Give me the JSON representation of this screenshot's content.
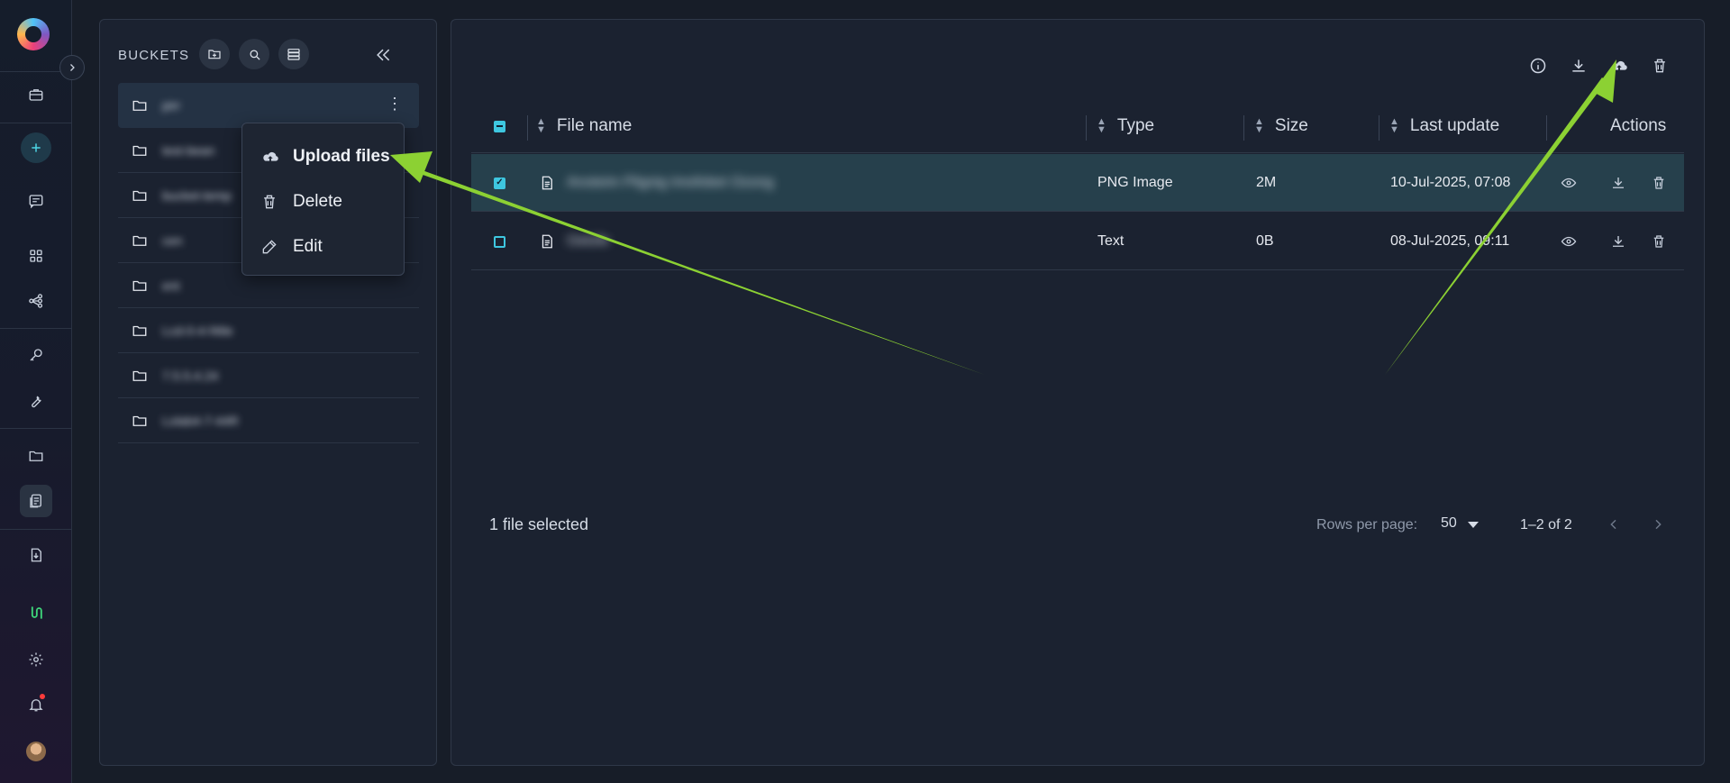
{
  "sidebar": {
    "expand_icon": "chevron-right-icon",
    "items": [
      {
        "name": "briefcase-icon"
      },
      {
        "name": "plus-icon"
      },
      {
        "name": "chat-icon"
      },
      {
        "name": "grid-icon"
      },
      {
        "name": "workflow-icon"
      },
      {
        "name": "key-icon"
      },
      {
        "name": "wrench-icon"
      },
      {
        "name": "folder-icon"
      },
      {
        "name": "files-icon",
        "active": true
      },
      {
        "name": "file-download-icon"
      },
      {
        "name": "flow-icon"
      },
      {
        "name": "settings-icon"
      },
      {
        "name": "bell-icon"
      }
    ]
  },
  "buckets": {
    "title": "BUCKETS",
    "items": [
      {
        "label": "pirr"
      },
      {
        "label": "test-bean"
      },
      {
        "label": "bucket-temp"
      },
      {
        "label": "cen"
      },
      {
        "label": "ent"
      },
      {
        "label": "Lcd-0-4-f4tle"
      },
      {
        "label": "7.5.5.4.24"
      },
      {
        "label": "Lolab4-7-44R"
      }
    ]
  },
  "context_menu": {
    "items": [
      {
        "label": "Upload files"
      },
      {
        "label": "Delete"
      },
      {
        "label": "Edit"
      }
    ]
  },
  "files": {
    "columns": {
      "file_name": "File name",
      "type": "Type",
      "size": "Size",
      "last_update": "Last update",
      "actions": "Actions"
    },
    "rows": [
      {
        "name": "Anoteim Plignig Imofobet Ozong",
        "type": "PNG Image",
        "size": "2M",
        "last_update": "10-Jul-2025, 07:08",
        "selected": true
      },
      {
        "name": "Oelofe",
        "type": "Text",
        "size": "0B",
        "last_update": "08-Jul-2025, 09:11",
        "selected": false
      }
    ],
    "selection_text": "1 file selected",
    "rows_per_page_label": "Rows per page:",
    "rows_per_page": "50",
    "range_text": "1–2 of 2"
  },
  "colors": {
    "accent": "#3ec7e0",
    "arrow": "#8cd133",
    "selected_row": "#26404c"
  }
}
